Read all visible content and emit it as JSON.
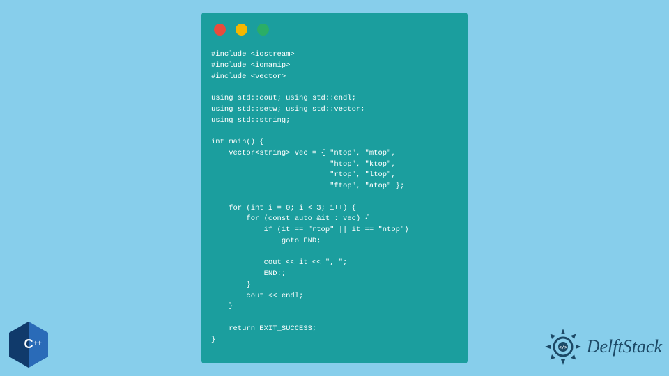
{
  "code": {
    "lines": [
      "#include <iostream>",
      "#include <iomanip>",
      "#include <vector>",
      "",
      "using std::cout; using std::endl;",
      "using std::setw; using std::vector;",
      "using std::string;",
      "",
      "int main() {",
      "    vector<string> vec = { \"ntop\", \"mtop\",",
      "                           \"htop\", \"ktop\",",
      "                           \"rtop\", \"ltop\",",
      "                           \"ftop\", \"atop\" };",
      "",
      "    for (int i = 0; i < 3; i++) {",
      "        for (const auto &it : vec) {",
      "            if (it == \"rtop\" || it == \"ntop\")",
      "                goto END;",
      "",
      "            cout << it << \", \";",
      "            END:;",
      "        }",
      "        cout << endl;",
      "    }",
      "",
      "    return EXIT_SUCCESS;",
      "}"
    ]
  },
  "badges": {
    "cpp": "C++",
    "brand": "DelftStack"
  },
  "colors": {
    "bg": "#87CEEB",
    "window": "#1B9E9E",
    "red": "#E94B3C",
    "yellow": "#F5B700",
    "green": "#2BAE66",
    "cppBlue": "#1B4F8C",
    "dsBlue": "#1C4966"
  }
}
